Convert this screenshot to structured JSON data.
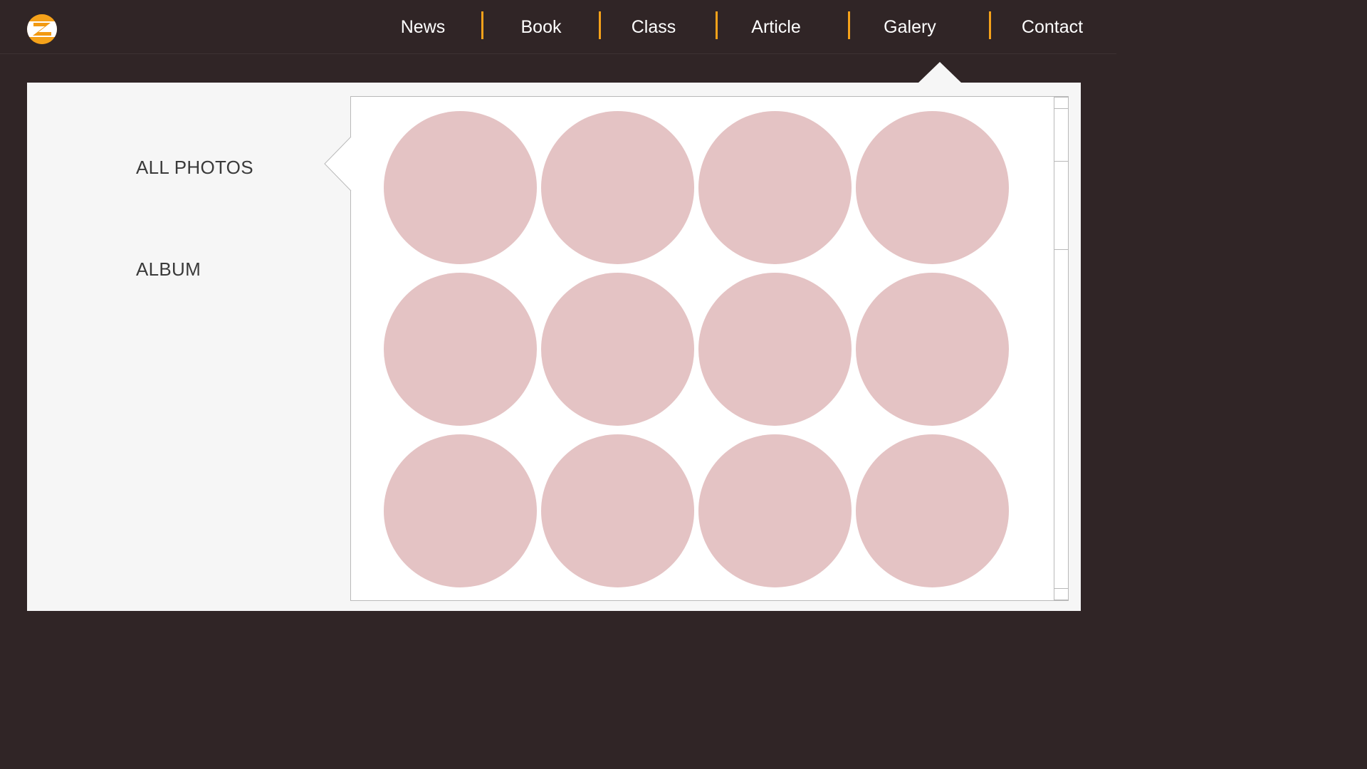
{
  "brand": {
    "logo_icon": "z-logo-icon",
    "accent_color": "#f5a21a"
  },
  "nav": {
    "items": [
      {
        "label": "News"
      },
      {
        "label": "Book"
      },
      {
        "label": "Class"
      },
      {
        "label": "Article"
      },
      {
        "label": "Galery"
      },
      {
        "label": "Contact"
      }
    ],
    "active": "Galery"
  },
  "sidebar": {
    "items": [
      {
        "label": "ALL PHOTOS"
      },
      {
        "label": "ALBUM"
      }
    ],
    "selected": "ALL PHOTOS"
  },
  "gallery": {
    "photo_placeholder_color": "#e4c3c4",
    "photo_count": 12
  }
}
